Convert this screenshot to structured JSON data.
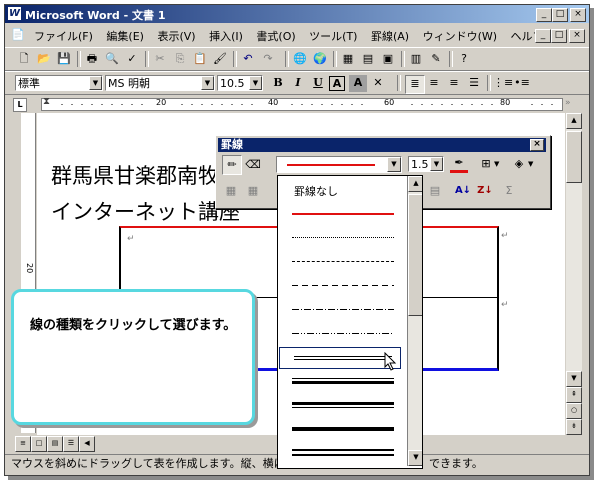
{
  "window": {
    "title": "Microsoft Word - 文書 1",
    "app_icon_letter": "W",
    "controls": [
      "_",
      "□",
      "×"
    ],
    "doc_controls": [
      "_",
      "□",
      "×"
    ]
  },
  "menubar": {
    "items": [
      "ファイル(F)",
      "編集(E)",
      "表示(V)",
      "挿入(I)",
      "書式(O)",
      "ツール(T)",
      "罫線(A)",
      "ウィンドウ(W)",
      "ヘルプ(H)"
    ]
  },
  "formatting": {
    "style": "標準",
    "font": "MS 明朝",
    "size": "10.5",
    "bold": "B",
    "italic": "I",
    "underline": "U",
    "charborder": "A",
    "charshade": "A"
  },
  "ruler": {
    "marks": [
      "20",
      "40",
      "60",
      "80"
    ],
    "vmark": "20"
  },
  "document": {
    "line1": "群馬県甘楽郡南牧",
    "line2": "インターネット講座",
    "para_mark": "↵"
  },
  "borders_toolbar": {
    "title": "罫線",
    "line_width": "1.5",
    "close": "×"
  },
  "line_style_dropdown": {
    "no_border_label": "罫線なし",
    "styles": [
      "solid-red",
      "dotted",
      "dashed-fine",
      "dashed",
      "dash-dot",
      "dash-dot-dot",
      "double",
      "thin-thick",
      "thick-thin",
      "thick",
      "thin-thick-thin",
      "triple"
    ],
    "selected": "double"
  },
  "callout": {
    "text": "線の種類をクリックして選びます。"
  },
  "status": {
    "text_left": "マウスを斜めにドラッグして表を作成します。縦、横にド",
    "text_right": "できます。"
  },
  "colors": {
    "titlebar": "#0a246a",
    "callout_border": "#58d8e0",
    "table_red": "#e01010",
    "table_blue": "#1010e0"
  }
}
